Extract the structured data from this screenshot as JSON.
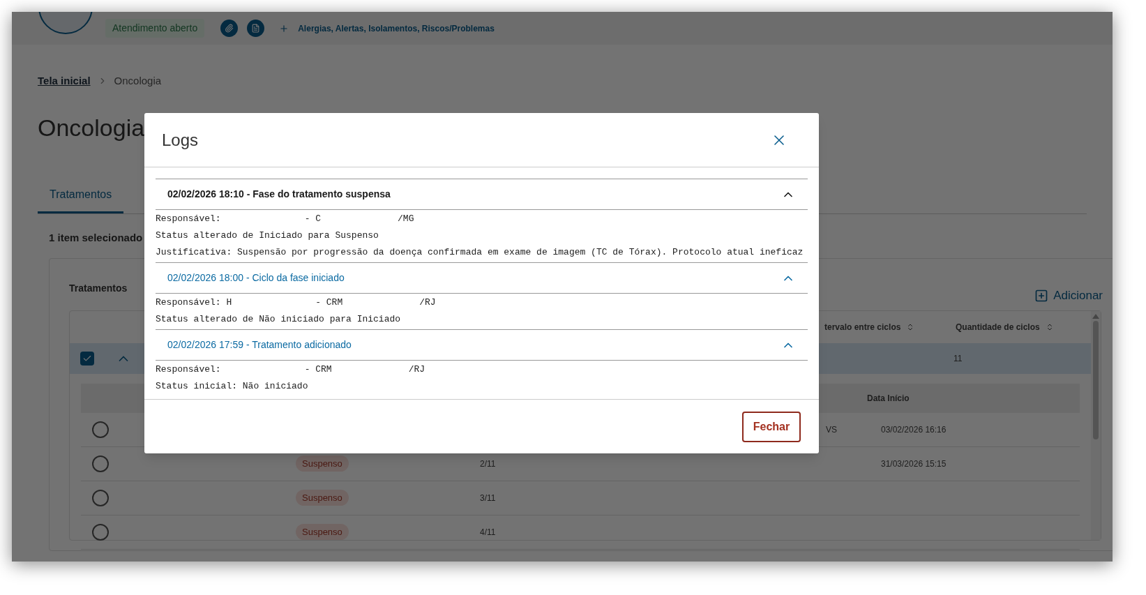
{
  "patient_header": {
    "status_badge": "Atendimento aberto",
    "link": "Alergias, Alertas, Isolamentos, Riscos/Problemas"
  },
  "breadcrumb": [
    {
      "label": "Tela inicial",
      "link": true
    },
    {
      "label": "Oncologia",
      "link": false
    }
  ],
  "page_title": "Oncologia",
  "tabs": [
    {
      "label": "Tratamentos",
      "selected": true
    }
  ],
  "selection_count": "1 item selecionado",
  "card": {
    "title": "Tratamentos",
    "add_button": "Adicionar",
    "table": {
      "columns": [
        "tervalo entre ciclos",
        "Quantidade de ciclos"
      ],
      "rows": [
        {
          "checked": true,
          "expanded": true,
          "cells": [
            "",
            "11"
          ]
        }
      ],
      "sub_table": {
        "columns": [
          "Data Início"
        ],
        "rows": [
          {
            "selected": false,
            "status": "",
            "cycle": "",
            "column_3": "VS",
            "start": "03/02/2026 16:16"
          },
          {
            "selected": false,
            "status": "Suspenso",
            "cycle": "2/11",
            "column_3": "",
            "start": "31/03/2026 15:15"
          },
          {
            "selected": false,
            "status": "Suspenso",
            "cycle": "3/11",
            "column_3": "",
            "start": ""
          },
          {
            "selected": false,
            "status": "Suspenso",
            "cycle": "4/11",
            "column_3": "",
            "start": ""
          }
        ]
      }
    }
  },
  "modal": {
    "title": "Logs",
    "close_button": "Fechar",
    "entries": [
      {
        "heading": "02/02/2026 18:10 - Fase do tratamento suspensa",
        "selected": true,
        "expanded": true,
        "lines": [
          [
            "Responsável:",
            "- C",
            "/MG"
          ],
          [
            "Status alterado de Iniciado para Suspenso"
          ],
          [
            "Justificativa: Suspensão por progressão da doença confirmada em exame de imagem (TC de Tórax). Protocolo atual ineficaz"
          ]
        ]
      },
      {
        "heading": "02/02/2026 18:00 - Ciclo da fase iniciado",
        "selected": false,
        "expanded": true,
        "lines": [
          [
            "Responsável: H",
            "- CRM",
            "/RJ"
          ],
          [
            "Status alterado de Não iniciado para Iniciado"
          ]
        ]
      },
      {
        "heading": "02/02/2026 17:59 - Tratamento adicionado",
        "selected": false,
        "expanded": true,
        "lines": [
          [
            "Responsável:",
            "- CRM",
            "/RJ"
          ],
          [
            "Status inicial: Não iniciado"
          ]
        ]
      }
    ]
  }
}
